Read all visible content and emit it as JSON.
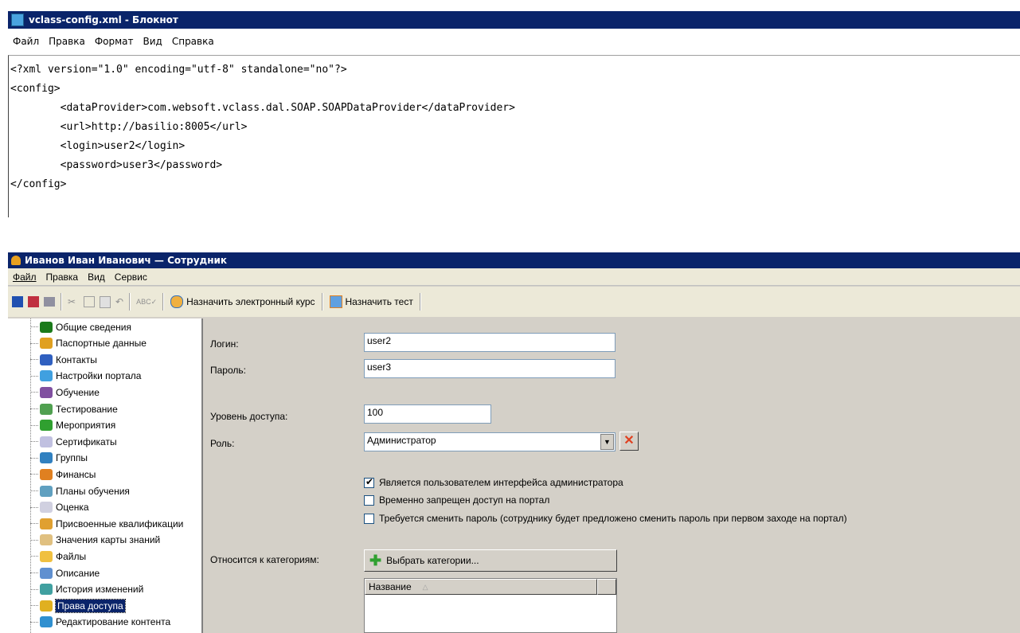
{
  "notepad": {
    "title": "vclass-config.xml - Блокнот",
    "menu": [
      "Файл",
      "Правка",
      "Формат",
      "Вид",
      "Справка"
    ],
    "lines": [
      "<?xml version=\"1.0\" encoding=\"utf-8\" standalone=\"no\"?>",
      "<config>",
      "        <dataProvider>com.websoft.vclass.dal.SOAP.SOAPDataProvider</dataProvider>",
      "        <url>http://basilio:8005</url>",
      "        <login>user2</login>",
      "        <password>user3</password>",
      "</config>"
    ]
  },
  "employee": {
    "title": "Иванов Иван Иванович — Сотрудник",
    "menu": [
      "Файл",
      "Правка",
      "Вид",
      "Сервис"
    ],
    "toolbar": {
      "assign_course": "Назначить электронный курс",
      "assign_test": "Назначить тест"
    },
    "tree": [
      {
        "label": "Общие сведения",
        "icon": "info-icon",
        "color": "#1a7a1a"
      },
      {
        "label": "Паспортные данные",
        "icon": "passport-icon",
        "color": "#e0a020"
      },
      {
        "label": "Контакты",
        "icon": "contacts-icon",
        "color": "#3060c0"
      },
      {
        "label": "Настройки портала",
        "icon": "globe-icon",
        "color": "#40a0e0"
      },
      {
        "label": "Обучение",
        "icon": "education-icon",
        "color": "#8050a0"
      },
      {
        "label": "Тестирование",
        "icon": "testing-icon",
        "color": "#50a050"
      },
      {
        "label": "Мероприятия",
        "icon": "events-icon",
        "color": "#30a030"
      },
      {
        "label": "Сертификаты",
        "icon": "certificate-icon",
        "color": "#c0c0e0"
      },
      {
        "label": "Группы",
        "icon": "groups-icon",
        "color": "#3080c0"
      },
      {
        "label": "Финансы",
        "icon": "finance-icon",
        "color": "#e08020"
      },
      {
        "label": "Планы обучения",
        "icon": "plans-icon",
        "color": "#60a0c0"
      },
      {
        "label": "Оценка",
        "icon": "assessment-icon",
        "color": "#d0d0e0"
      },
      {
        "label": "Присвоенные квалификации",
        "icon": "qualification-icon",
        "color": "#e0a030"
      },
      {
        "label": "Значения карты знаний",
        "icon": "knowledge-map-icon",
        "color": "#e0c080"
      },
      {
        "label": "Файлы",
        "icon": "folder-icon",
        "color": "#f0c040"
      },
      {
        "label": "Описание",
        "icon": "description-icon",
        "color": "#6090d0"
      },
      {
        "label": "История изменений",
        "icon": "history-icon",
        "color": "#40a0a0"
      },
      {
        "label": "Права доступа",
        "icon": "access-rights-icon",
        "color": "#e0b020",
        "selected": true
      },
      {
        "label": "Редактирование контента",
        "icon": "content-edit-icon",
        "color": "#3090d0"
      }
    ],
    "form": {
      "login_label": "Логин:",
      "login_value": "user2",
      "password_label": "Пароль:",
      "password_value": "user3",
      "access_level_label": "Уровень доступа:",
      "access_level_value": "100",
      "role_label": "Роль:",
      "role_value": "Администратор",
      "checkbox_admin": "Является пользователем интерфейса администратора",
      "checkbox_admin_checked": true,
      "checkbox_banned": "Временно запрещен доступ на портал",
      "checkbox_change_pw": "Требуется сменить пароль (сотруднику будет предложено сменить пароль при первом заходе на портал)",
      "categories_label": "Относится к категориям:",
      "select_categories_button": "Выбрать категории...",
      "table_header_name": "Название"
    }
  }
}
